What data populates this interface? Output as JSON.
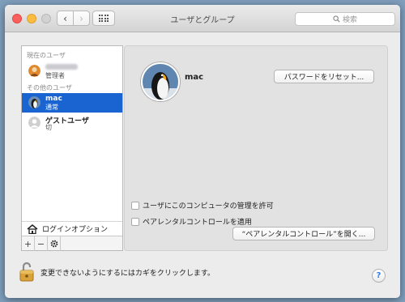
{
  "window": {
    "title": "ユーザとグループ"
  },
  "toolbar": {
    "back_glyph": "‹",
    "forward_glyph": "›",
    "search_placeholder": "検索"
  },
  "sidebar": {
    "current_header": "現在のユーザ",
    "current_user": {
      "role": "管理者"
    },
    "other_header": "その他のユーザ",
    "users": [
      {
        "name": "mac",
        "role": "通常"
      },
      {
        "name": "ゲストユーザ",
        "role": "切"
      }
    ],
    "login_options": "ログインオプション",
    "add_glyph": "+",
    "remove_glyph": "−"
  },
  "detail": {
    "user_name": "mac",
    "reset_password_button": "パスワードをリセット...",
    "allow_admin_label": "ユーザにこのコンピュータの管理を許可",
    "parental_controls_label": "ペアレンタルコントロールを適用",
    "open_parental_button": "“ペアレンタルコントロール”を開く..."
  },
  "footer": {
    "lock_text": "変更できないようにするにはカギをクリックします。",
    "help_glyph": "?"
  }
}
